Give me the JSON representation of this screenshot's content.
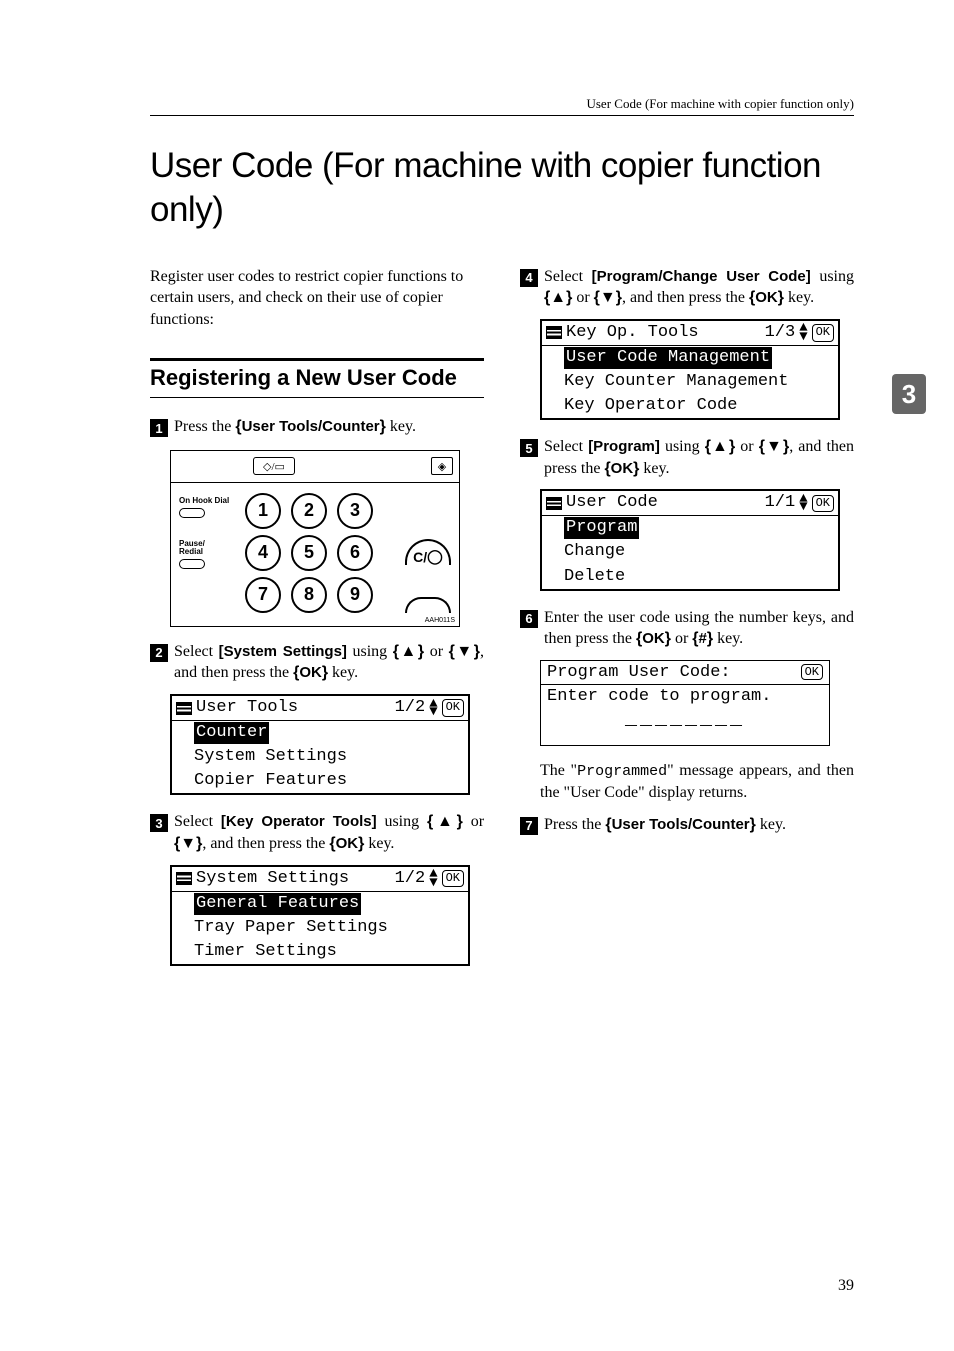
{
  "header": {
    "running_head": "User Code (For machine with copier function only)"
  },
  "title": "User Code (For machine with copier function only)",
  "intro": "Register user codes to restrict copier functions to certain users, and check on their use of copier functions:",
  "section": {
    "heading": "Registering a New User Code"
  },
  "steps": {
    "s1": {
      "num": "1",
      "pre": "Press the ",
      "key": "User Tools/Counter",
      "post": " key."
    },
    "s2": {
      "num": "2",
      "pre": "Select ",
      "bold": "[System Settings]",
      "mid": " using ",
      "post": ", and then press the ",
      "key": "OK",
      "tail": " key."
    },
    "s3": {
      "num": "3",
      "pre": "Select ",
      "bold": "[Key Operator Tools]",
      "mid": " using ",
      "post": ", and then press the ",
      "key": "OK",
      "tail": " key."
    },
    "s4": {
      "num": "4",
      "pre": "Select ",
      "bold": "[Program/Change User Code]",
      "mid": " using ",
      "post": ", and then press the ",
      "key": "OK",
      "tail": " key."
    },
    "s5": {
      "num": "5",
      "pre": "Select ",
      "bold": "[Program]",
      "mid": " using ",
      "post": ", and then press the ",
      "key": "OK",
      "tail": " key."
    },
    "s6": {
      "num": "6",
      "pre": "Enter the user code using the number keys, and then press the ",
      "key1": "OK",
      "mid": " or ",
      "key2": "#",
      "tail": " key."
    },
    "s7": {
      "num": "7",
      "pre": "Press the ",
      "key": "User Tools/Counter",
      "post": " key."
    }
  },
  "keypad": {
    "label1": "On Hook Dial",
    "label2_a": "Pause/",
    "label2_b": "Redial",
    "side": "C/",
    "caption": "AAH011S",
    "keys": [
      "1",
      "2",
      "3",
      "4",
      "5",
      "6",
      "7",
      "8",
      "9"
    ]
  },
  "lcd1": {
    "title": "User Tools",
    "page": "1/2",
    "sel": "Counter",
    "row2": "System Settings",
    "row3": "Copier Features"
  },
  "lcd2": {
    "title": "System Settings",
    "page": "1/2",
    "sel": "General Features",
    "row2": "Tray Paper Settings",
    "row3": "Timer Settings"
  },
  "lcd3": {
    "title": "Key Op. Tools",
    "page": "1/3",
    "sel": "User Code Management",
    "row2": "Key Counter Management",
    "row3": "Key Operator Code"
  },
  "lcd4": {
    "title": "User Code",
    "page": "1/1",
    "sel": "Program",
    "row2": "Change",
    "row3": "Delete"
  },
  "lcd5": {
    "title": "Program User Code:",
    "row2": "Enter code to program.",
    "blanks": "________"
  },
  "note": {
    "t1": "The \"",
    "code": "Programmed",
    "t2": "\" message appears, and then the \"User Code\" display returns."
  },
  "side_chapter": "3",
  "page_number": "39",
  "glyphs": {
    "up": "▲",
    "down": "▼",
    "updown": "◆",
    "ok": "OK",
    "copy": "◇/▭",
    "diamond": "◈",
    "stop": "◯"
  }
}
